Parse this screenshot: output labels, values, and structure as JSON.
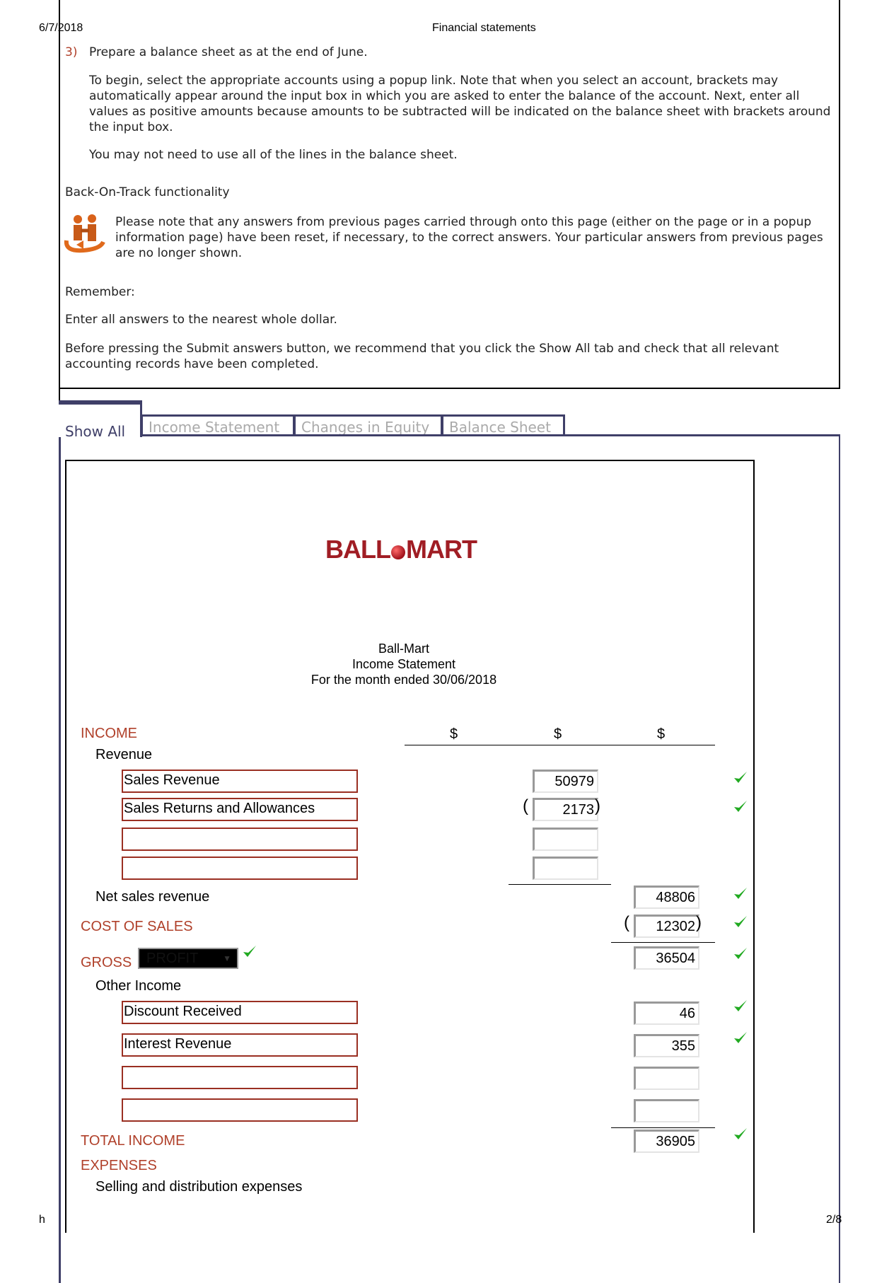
{
  "header": {
    "date": "6/7/2018",
    "title": "Financial statements"
  },
  "footer": {
    "left": "h",
    "page": "2/8"
  },
  "instructions": {
    "number": "3)",
    "task": "Prepare a balance sheet as at the end of June.",
    "para1": "To begin, select the appropriate accounts using a popup link. Note that when you select an account, brackets may automatically appear around the input box in which you are asked to enter the balance of the account. Next, enter all values as positive amounts because amounts to be subtracted will be indicated on the balance sheet with brackets around the input box.",
    "para2": "You may not need to use all of the lines in the balance sheet.",
    "bot_title": "Back-On-Track functionality",
    "bot_text": "Please note that any answers from previous pages carried through onto this page (either on the page or in a popup information page) have been reset, if necessary, to the correct answers. Your particular answers from previous pages are no longer shown.",
    "remember": "Remember:",
    "rule1": "Enter all answers to the nearest whole dollar.",
    "rule2": "Before pressing the Submit answers button, we recommend that you click the Show All tab and check that all relevant accounting records have been completed."
  },
  "tabs": [
    {
      "label": "Show All",
      "active": true
    },
    {
      "label": "Income Statement",
      "active": false
    },
    {
      "label": "Changes in Equity",
      "active": false
    },
    {
      "label": "Balance Sheet",
      "active": false
    }
  ],
  "statement": {
    "logo": "BALL MART",
    "company": "Ball-Mart",
    "name": "Income Statement",
    "period": "For the month ended 30/06/2018",
    "currency": [
      "$",
      "$",
      "$"
    ],
    "income": "INCOME",
    "revenue": "Revenue",
    "revenue_accounts": [
      "Sales Revenue",
      "Sales Returns and Allowances",
      "",
      ""
    ],
    "revenue_values": [
      "50979",
      "2173",
      "",
      ""
    ],
    "net_sales_label": "Net sales revenue",
    "net_sales": "48806",
    "cost_of_sales_label": "COST OF SALES",
    "cost_of_sales": "12302",
    "gross_label": "GROSS",
    "gross_select": "PROFIT",
    "gross_value": "36504",
    "other_income": "Other Income",
    "other_accounts": [
      "Discount Received",
      "Interest Revenue",
      "",
      ""
    ],
    "other_values": [
      "46",
      "355",
      "",
      ""
    ],
    "total_income_label": "TOTAL INCOME",
    "total_income": "36905",
    "expenses": "EXPENSES",
    "selling": "Selling and distribution expenses"
  },
  "colors": {
    "accent_red": "#b0402a",
    "tab_border": "#3f3f68",
    "check_green": "#22aa22",
    "logo_red": "#a01d24"
  }
}
